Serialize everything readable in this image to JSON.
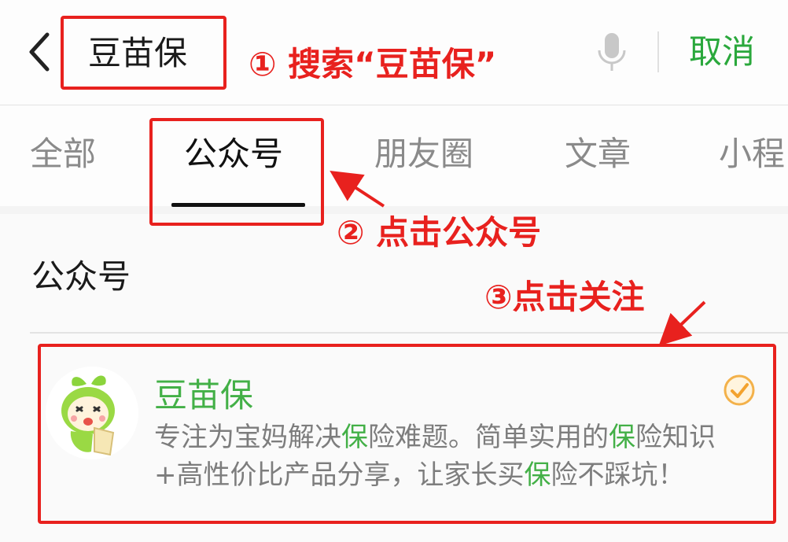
{
  "search": {
    "query": "豆苗保",
    "cancel_label": "取消"
  },
  "tabs": [
    {
      "label": "全部"
    },
    {
      "label": "公众号",
      "active": true
    },
    {
      "label": "朋友圈"
    },
    {
      "label": "文章"
    },
    {
      "label": "小程"
    }
  ],
  "results": {
    "section_title": "公众号",
    "account": {
      "name": "豆苗保",
      "desc_segments": [
        "专注为宝妈解决",
        "保",
        "险难题。简单实用的",
        "保",
        "险知识",
        "+高性价比产品分享，让家长买",
        "保",
        "险不踩坑！"
      ]
    }
  },
  "annotations": {
    "step1": "① 搜索“豆苗保”",
    "step2": "② 点击公众号",
    "step3": "③点击关注"
  },
  "colors": {
    "accent_green": "#43b047",
    "cancel_green": "#2aa83c",
    "annotation_red": "#e8211e"
  }
}
